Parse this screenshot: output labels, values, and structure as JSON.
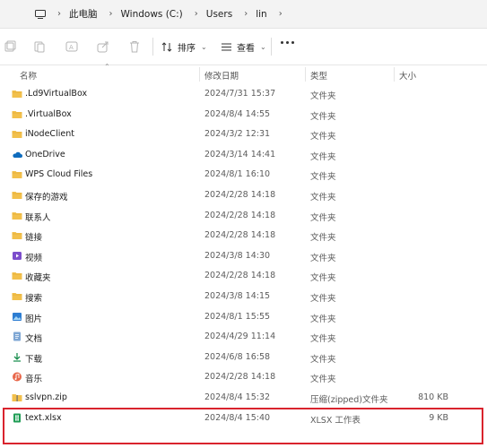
{
  "address": {
    "crumbs": [
      "此电脑",
      "Windows (C:)",
      "Users",
      "lin"
    ]
  },
  "toolbar": {
    "sort_label": "排序",
    "view_label": "查看"
  },
  "columns": {
    "name": "名称",
    "modified": "修改日期",
    "type": "类型",
    "size": "大小"
  },
  "rows": [
    {
      "name": ".Ld9VirtualBox",
      "modified": "2024/7/31 15:37",
      "type": "文件夹",
      "size": "",
      "icon": "folder-icon"
    },
    {
      "name": ".VirtualBox",
      "modified": "2024/8/4 14:55",
      "type": "文件夹",
      "size": "",
      "icon": "folder-icon"
    },
    {
      "name": "iNodeClient",
      "modified": "2024/3/2 12:31",
      "type": "文件夹",
      "size": "",
      "icon": "folder-icon"
    },
    {
      "name": "OneDrive",
      "modified": "2024/3/14 14:41",
      "type": "文件夹",
      "size": "",
      "icon": "onedrive-cloud-icon"
    },
    {
      "name": "WPS Cloud Files",
      "modified": "2024/8/1 16:10",
      "type": "文件夹",
      "size": "",
      "icon": "folder-icon"
    },
    {
      "name": "保存的游戏",
      "modified": "2024/2/28 14:18",
      "type": "文件夹",
      "size": "",
      "icon": "folder-icon"
    },
    {
      "name": "联系人",
      "modified": "2024/2/28 14:18",
      "type": "文件夹",
      "size": "",
      "icon": "folder-icon"
    },
    {
      "name": "链接",
      "modified": "2024/2/28 14:18",
      "type": "文件夹",
      "size": "",
      "icon": "folder-icon"
    },
    {
      "name": "视频",
      "modified": "2024/3/8 14:30",
      "type": "文件夹",
      "size": "",
      "icon": "videos-folder-icon"
    },
    {
      "name": "收藏夹",
      "modified": "2024/2/28 14:18",
      "type": "文件夹",
      "size": "",
      "icon": "folder-icon"
    },
    {
      "name": "搜索",
      "modified": "2024/3/8 14:15",
      "type": "文件夹",
      "size": "",
      "icon": "folder-icon"
    },
    {
      "name": "图片",
      "modified": "2024/8/1 15:55",
      "type": "文件夹",
      "size": "",
      "icon": "pictures-folder-icon"
    },
    {
      "name": "文档",
      "modified": "2024/4/29 11:14",
      "type": "文件夹",
      "size": "",
      "icon": "documents-folder-icon"
    },
    {
      "name": "下载",
      "modified": "2024/6/8 16:58",
      "type": "文件夹",
      "size": "",
      "icon": "downloads-folder-icon"
    },
    {
      "name": "音乐",
      "modified": "2024/2/28 14:18",
      "type": "文件夹",
      "size": "",
      "icon": "music-folder-icon"
    },
    {
      "name": "sslvpn.zip",
      "modified": "2024/8/4 15:32",
      "type": "压缩(zipped)文件夹",
      "size": "810 KB",
      "icon": "zip-folder-icon"
    },
    {
      "name": "text.xlsx",
      "modified": "2024/8/4 15:40",
      "type": "XLSX 工作表",
      "size": "9 KB",
      "icon": "excel-file-icon"
    }
  ],
  "colors": {
    "folder": "#f2c04c",
    "highlight": "#d9232d",
    "onedrive": "#0f6cbd",
    "excel": "#1f9d55"
  }
}
